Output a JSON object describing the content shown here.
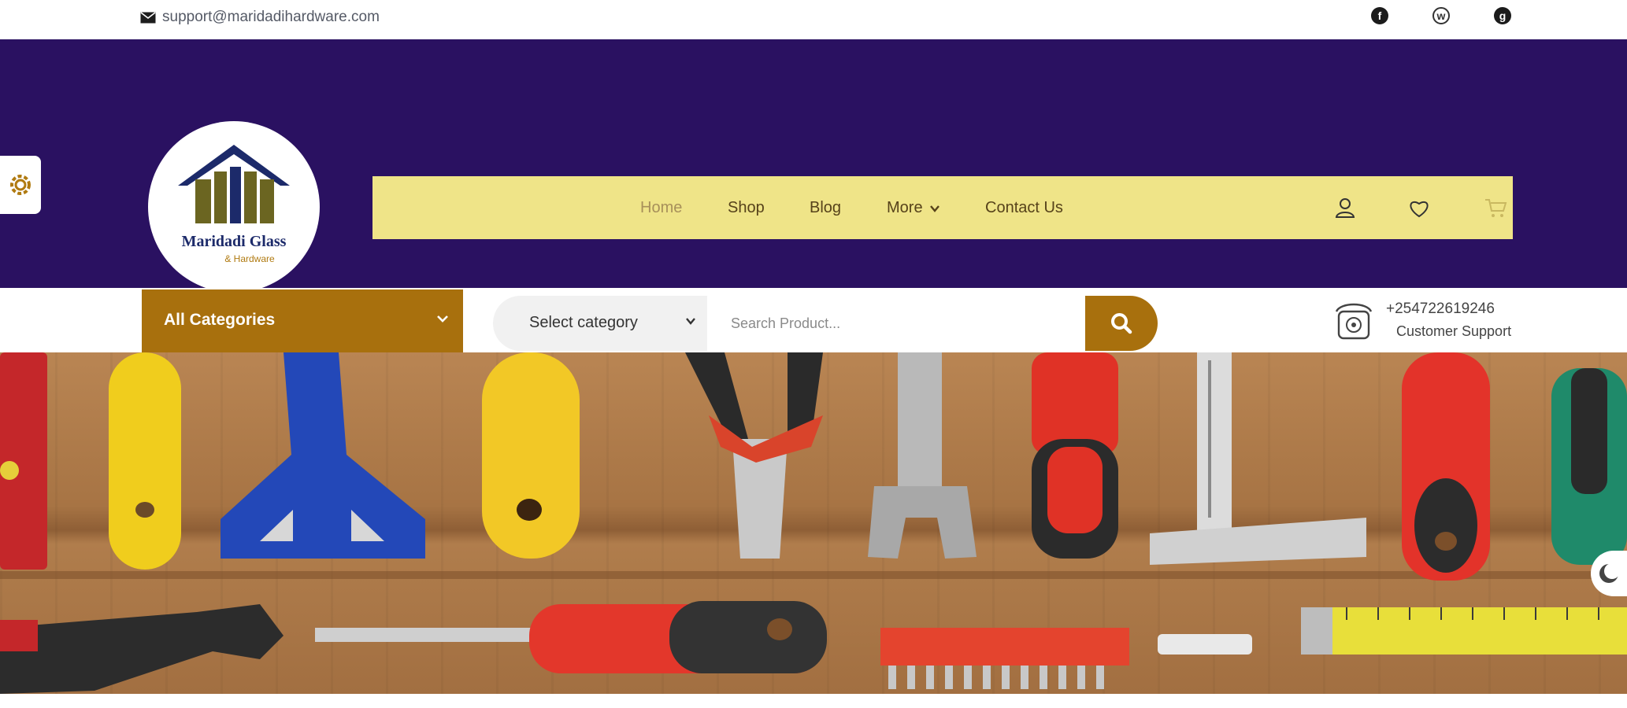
{
  "topbar": {
    "email": "support@maridadihardware.com",
    "social": [
      {
        "name": "facebook-icon",
        "glyph": "f"
      },
      {
        "name": "whatsapp-icon",
        "glyph": "w"
      },
      {
        "name": "globe-icon",
        "glyph": "g"
      }
    ]
  },
  "brand": {
    "name": "Maridadi Glass",
    "tagline": "& Hardware"
  },
  "nav": {
    "items": [
      "Home",
      "Shop",
      "Blog",
      "More",
      "Contact Us"
    ],
    "active": "Home"
  },
  "search": {
    "all_categories_label": "All Categories",
    "select_category_label": "Select category",
    "placeholder": "Search Product..."
  },
  "support": {
    "phone": "+254722619246",
    "label": "Customer Support"
  },
  "colors": {
    "header_bg": "#2a1161",
    "nav_bg": "#efe488",
    "accent": "#a8700d"
  }
}
